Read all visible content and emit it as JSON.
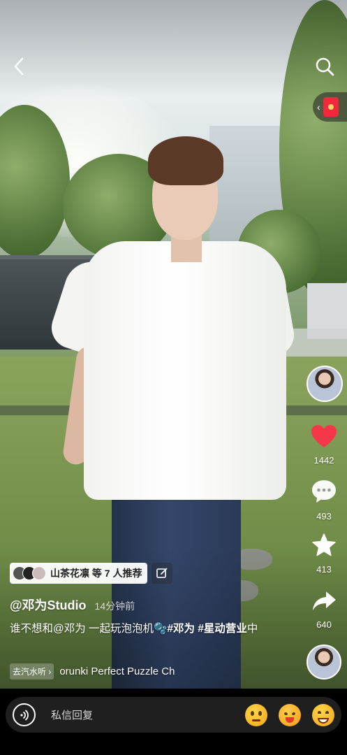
{
  "header": {
    "back_icon": "chevron-left-icon",
    "search_icon": "search-icon",
    "red_packet_icon": "red-packet-icon"
  },
  "actions": {
    "like": {
      "icon": "heart-icon",
      "count": "1442",
      "color": "#f5374a"
    },
    "comment": {
      "icon": "comment-dots-icon",
      "count": "493"
    },
    "favorite": {
      "icon": "star-icon",
      "count": "413"
    },
    "share": {
      "icon": "share-arrow-icon",
      "count": "640"
    }
  },
  "recommend": {
    "text": "山茶花凛 等 7 人推荐",
    "edit_icon": "edit-icon"
  },
  "post": {
    "author": "@邓为Studio",
    "time": "14分钟前",
    "caption_plain": "谁不想和@邓为 一起玩泡泡机🫧",
    "tag1": "#邓为",
    "tag2": "#星动营业",
    "caption_end": "中"
  },
  "music": {
    "badge": "去汽水听 ›",
    "title": "orunki Perfect Puzzle Ch"
  },
  "reply": {
    "placeholder": "私信回复",
    "voice_icon": "voice-icon",
    "emojis": [
      "rolling-eyes-emoji",
      "angry-emoji",
      "grin-emoji"
    ]
  }
}
